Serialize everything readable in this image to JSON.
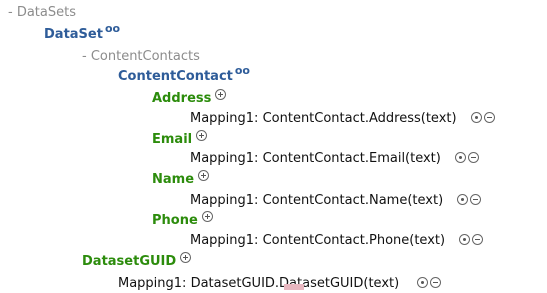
{
  "tree": {
    "datasets_label": "- DataSets",
    "dataset_label": "DataSet",
    "content_contacts_label": "- ContentContacts",
    "content_contact_label": "ContentContact",
    "repeat_symbol": "oo",
    "fields": [
      {
        "name": "Address",
        "mapping": "Mapping1: ContentContact.Address(text)"
      },
      {
        "name": "Email",
        "mapping": "Mapping1: ContentContact.Email(text)"
      },
      {
        "name": "Name",
        "mapping": "Mapping1: ContentContact.Name(text)"
      },
      {
        "name": "Phone",
        "mapping": "Mapping1: ContentContact.Phone(text)"
      }
    ],
    "dataset_guid_label": "DatasetGUID",
    "dataset_guid_mapping": "Mapping1: DatasetGUID.DatasetGUID(text)"
  }
}
